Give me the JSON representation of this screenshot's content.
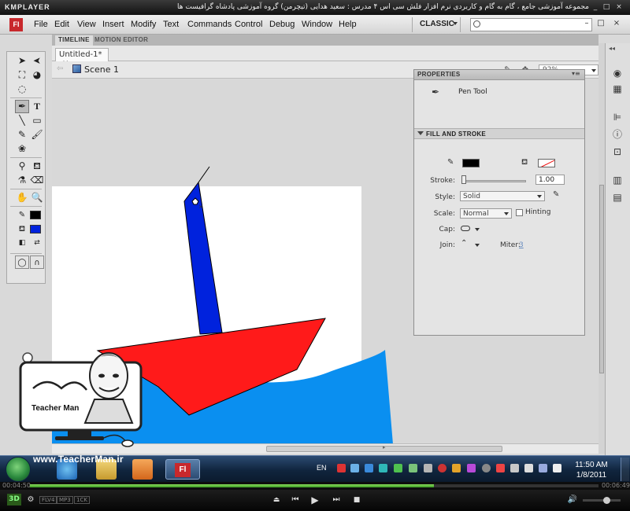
{
  "kmplayer": {
    "logo": "KMPLAYER",
    "title": "مجموعه آموزشی جامع ، گام به گام و کاربردی نرم افزار فلش سی اس ۴ مدرس : سعید هدایی (تیچرمن) گروه آموزشی پادشاه گرافیست ها",
    "btn_min": "_",
    "btn_max": "□",
    "btn_close": "×"
  },
  "app": {
    "logo": "Fl",
    "menu": [
      "File",
      "Edit",
      "View",
      "Insert",
      "Modify",
      "Text",
      "Commands",
      "Control",
      "Debug",
      "Window",
      "Help"
    ],
    "workspace": "CLASSIC",
    "search_placeholder": "",
    "btn_min": "–",
    "btn_max": "□",
    "btn_close": "×"
  },
  "panels": {
    "timeline": "TIMELINE",
    "motion_editor": "MOTION EDITOR"
  },
  "document": {
    "tab_label": "Untitled-1*",
    "tab_close": "×",
    "scene": "Scene 1",
    "zoom": "92%"
  },
  "properties": {
    "title": "PROPERTIES",
    "tool_name": "Pen Tool",
    "section": "FILL AND STROKE",
    "stroke_label": "Stroke:",
    "stroke_value": "1.00",
    "style_label": "Style:",
    "style_value": "Solid",
    "scale_label": "Scale:",
    "scale_value": "Normal",
    "hinting_label": "Hinting",
    "cap_label": "Cap:",
    "join_label": "Join:",
    "miter_label": "Miter:",
    "miter_value": "3",
    "colors": {
      "stroke": "#000000",
      "fill": "none"
    }
  },
  "stage": {
    "colors": {
      "sail": "#0022dd",
      "hull": "#ff1a1a",
      "water": "#0a8ff0",
      "stage": "#ffffff"
    }
  },
  "watermark": {
    "url": "www.TeacherMan.ir",
    "brand": "Teacher Man"
  },
  "taskbar": {
    "lang": "EN",
    "time": "11:50 AM",
    "date": "1/8/2011"
  },
  "player": {
    "elapsed": "00:04:50",
    "total": "00:06:49",
    "progress": 0.71,
    "badge_3d": "3D",
    "badge_fps": "FLV4",
    "badge_mp3": "MP3",
    "badge_1ck": "1CK"
  }
}
